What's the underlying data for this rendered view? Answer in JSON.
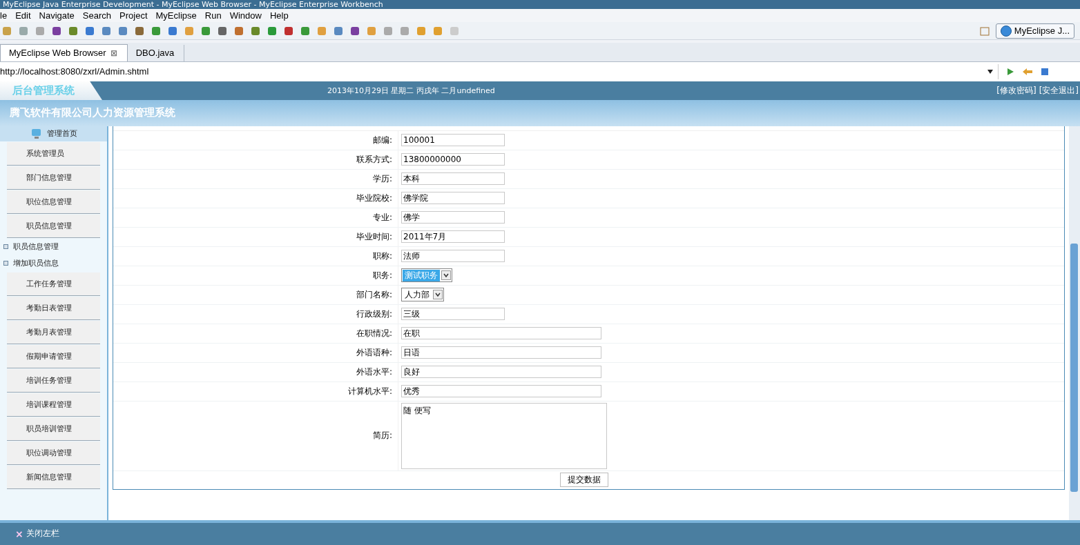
{
  "window": {
    "title": "MyEclipse Java Enterprise Development - MyEclipse Web Browser - MyEclipse Enterprise Workbench"
  },
  "menu": [
    "le",
    "Edit",
    "Navigate",
    "Search",
    "Project",
    "MyEclipse",
    "Run",
    "Window",
    "Help"
  ],
  "perspective": {
    "label": "MyEclipse J..."
  },
  "editor_tabs": [
    {
      "label": "MyEclipse Web Browser",
      "selected": true,
      "close_icon": "⊠"
    },
    {
      "label": "DBO.java",
      "selected": false
    }
  ],
  "browser": {
    "url": "http://localhost:8080/zxrl/Admin.shtml"
  },
  "page": {
    "logo": "后台管理系统",
    "date": "2013年10月29日 星期二 丙戌年 二月undefined",
    "header_links": [
      "[修改密码]",
      "[安全退出]"
    ],
    "system_title": "腾飞软件有限公司人力资源管理系统",
    "home": "管理首页",
    "sidebar": [
      {
        "label": "系统管理员",
        "kind": "section"
      },
      {
        "label": "部门信息管理",
        "kind": "section"
      },
      {
        "label": "职位信息管理",
        "kind": "section"
      },
      {
        "label": "职员信息管理",
        "kind": "section"
      },
      {
        "label": "职员信息管理",
        "kind": "sub"
      },
      {
        "label": "增加职员信息",
        "kind": "sub"
      },
      {
        "label": "工作任务管理",
        "kind": "section"
      },
      {
        "label": "考勤日表管理",
        "kind": "section"
      },
      {
        "label": "考勤月表管理",
        "kind": "section"
      },
      {
        "label": "假期申请管理",
        "kind": "section"
      },
      {
        "label": "培训任务管理",
        "kind": "section"
      },
      {
        "label": "培训课程管理",
        "kind": "section"
      },
      {
        "label": "职员培训管理",
        "kind": "section"
      },
      {
        "label": "职位调动管理",
        "kind": "section"
      },
      {
        "label": "新闻信息管理",
        "kind": "section"
      }
    ],
    "form": [
      {
        "label": "邮编:",
        "kind": "text",
        "value": "100001",
        "wide": false
      },
      {
        "label": "联系方式:",
        "kind": "text",
        "value": "13800000000",
        "wide": false
      },
      {
        "label": "学历:",
        "kind": "text",
        "value": "本科",
        "wide": false
      },
      {
        "label": "毕业院校:",
        "kind": "text",
        "value": "佛学院",
        "wide": false
      },
      {
        "label": "专业:",
        "kind": "text",
        "value": "佛学",
        "wide": false
      },
      {
        "label": "毕业时间:",
        "kind": "text",
        "value": "2011年7月",
        "wide": false
      },
      {
        "label": "职称:",
        "kind": "text",
        "value": "法师",
        "wide": false
      },
      {
        "label": "职务:",
        "kind": "select",
        "value": "测试职务",
        "focused": true
      },
      {
        "label": "部门名称:",
        "kind": "select",
        "value": "人力部",
        "focused": false
      },
      {
        "label": "行政级别:",
        "kind": "text",
        "value": "三级",
        "wide": false
      },
      {
        "label": "在职情况:",
        "kind": "text",
        "value": "在职",
        "wide": true
      },
      {
        "label": "外语语种:",
        "kind": "text",
        "value": "日语",
        "wide": true
      },
      {
        "label": "外语水平:",
        "kind": "text",
        "value": "良好",
        "wide": true
      },
      {
        "label": "计算机水平:",
        "kind": "text",
        "value": "优秀",
        "wide": true
      },
      {
        "label": "简历:",
        "kind": "textarea",
        "value": "随 便写"
      }
    ],
    "submit": "提交数据",
    "close_sidebar": {
      "icon": "×",
      "label": "关闭左栏"
    }
  }
}
